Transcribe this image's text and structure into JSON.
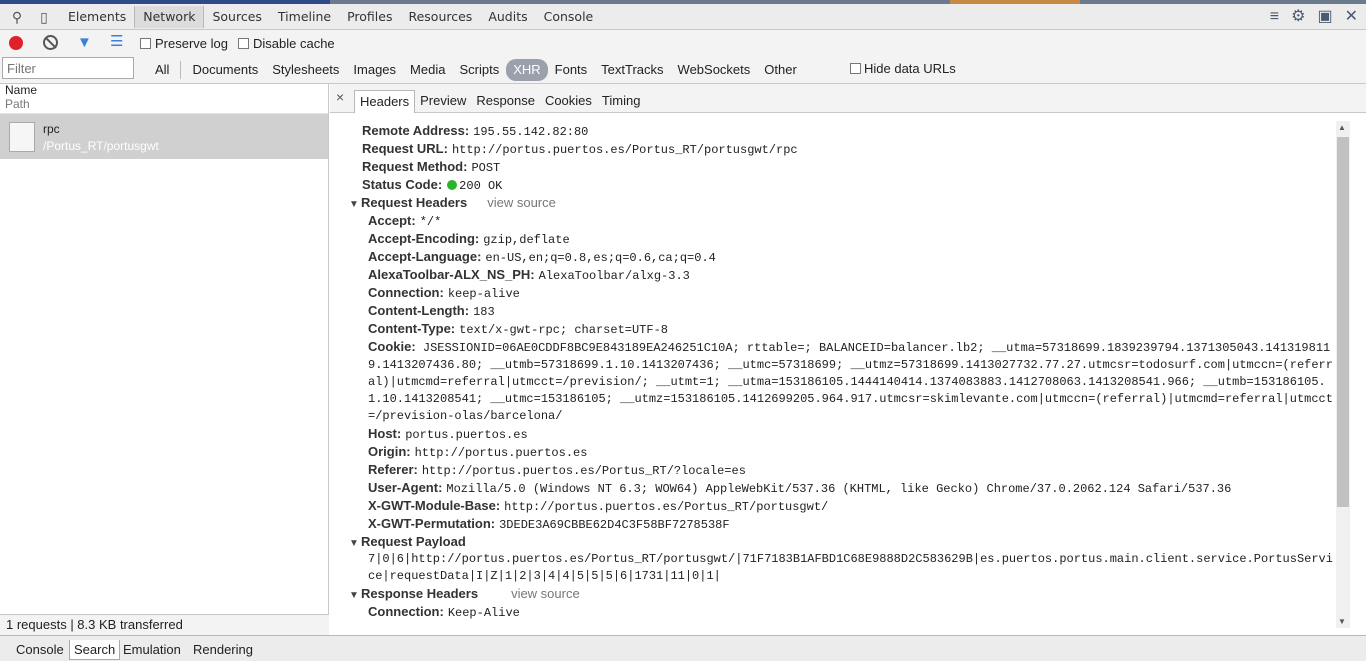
{
  "toolbar": {
    "tabs": [
      "Elements",
      "Network",
      "Sources",
      "Timeline",
      "Profiles",
      "Resources",
      "Audits",
      "Console"
    ],
    "active_tab": "Network"
  },
  "network": {
    "preserve_log": "Preserve log",
    "disable_cache": "Disable cache",
    "filter_placeholder": "Filter",
    "types": [
      "All",
      "Documents",
      "Stylesheets",
      "Images",
      "Media",
      "Scripts",
      "XHR",
      "Fonts",
      "TextTracks",
      "WebSockets",
      "Other"
    ],
    "active_type": "XHR",
    "hide_data_urls": "Hide data URLs"
  },
  "request_list": {
    "col_name": "Name",
    "col_path": "Path",
    "rows": [
      {
        "name": "rpc",
        "path": "/Portus_RT/portusgwt"
      }
    ],
    "summary": "1 requests | 8.3 KB transferred"
  },
  "detail": {
    "close": "×",
    "tabs": [
      "Headers",
      "Preview",
      "Response",
      "Cookies",
      "Timing"
    ],
    "active_tab": "Headers",
    "general": [
      {
        "k": "Remote Address:",
        "v": "195.55.142.82:80"
      },
      {
        "k": "Request URL:",
        "v": "http://portus.puertos.es/Portus_RT/portusgwt/rpc"
      },
      {
        "k": "Request Method:",
        "v": "POST"
      },
      {
        "k": "Status Code:",
        "v": "200 OK"
      }
    ],
    "request_headers_title": "Request Headers",
    "view_source": "view source",
    "request_headers": [
      {
        "k": "Accept:",
        "v": "*/*"
      },
      {
        "k": "Accept-Encoding:",
        "v": "gzip,deflate"
      },
      {
        "k": "Accept-Language:",
        "v": "en-US,en;q=0.8,es;q=0.6,ca;q=0.4"
      },
      {
        "k": "AlexaToolbar-ALX_NS_PH:",
        "v": "AlexaToolbar/alxg-3.3"
      },
      {
        "k": "Connection:",
        "v": "keep-alive"
      },
      {
        "k": "Content-Length:",
        "v": "183"
      },
      {
        "k": "Content-Type:",
        "v": "text/x-gwt-rpc; charset=UTF-8"
      }
    ],
    "cookie_key": "Cookie:",
    "cookie_value": "JSESSIONID=06AE0CDDF8BC9E843189EA246251C10A; rttable=; BALANCEID=balancer.lb2; __utma=57318699.1839239794.1371305043.1413198119.1413207436.80; __utmb=57318699.1.10.1413207436; __utmc=57318699; __utmz=57318699.1413027732.77.27.utmcsr=todosurf.com|utmccn=(referral)|utmcmd=referral|utmcct=/prevision/; __utmt=1; __utma=153186105.1444140414.1374083883.1412708063.1413208541.966; __utmb=153186105.1.10.1413208541; __utmc=153186105; __utmz=153186105.1412699205.964.917.utmcsr=skimlevante.com|utmccn=(referral)|utmcmd=referral|utmcct=/prevision-olas/barcelona/",
    "request_headers_2": [
      {
        "k": "Host:",
        "v": "portus.puertos.es"
      },
      {
        "k": "Origin:",
        "v": "http://portus.puertos.es"
      },
      {
        "k": "Referer:",
        "v": "http://portus.puertos.es/Portus_RT/?locale=es"
      },
      {
        "k": "User-Agent:",
        "v": "Mozilla/5.0 (Windows NT 6.3; WOW64) AppleWebKit/537.36 (KHTML, like Gecko) Chrome/37.0.2062.124 Safari/537.36"
      },
      {
        "k": "X-GWT-Module-Base:",
        "v": "http://portus.puertos.es/Portus_RT/portusgwt/"
      },
      {
        "k": "X-GWT-Permutation:",
        "v": "3DEDE3A69CBBE62D4C3F58BF7278538F"
      }
    ],
    "payload_title": "Request Payload",
    "payload": "7|0|6|http://portus.puertos.es/Portus_RT/portusgwt/|71F7183B1AFBD1C68E9888D2C583629B|es.puertos.portus.main.client.service.PortusService|requestData|I|Z|1|2|3|4|4|5|5|5|6|1731|11|0|1|",
    "response_headers_title": "Response Headers",
    "response_headers": [
      {
        "k": "Connection:",
        "v": "Keep-Alive"
      }
    ]
  },
  "drawer": {
    "tabs": [
      "Console",
      "Search",
      "Emulation",
      "Rendering"
    ],
    "active_tab": "Search"
  }
}
